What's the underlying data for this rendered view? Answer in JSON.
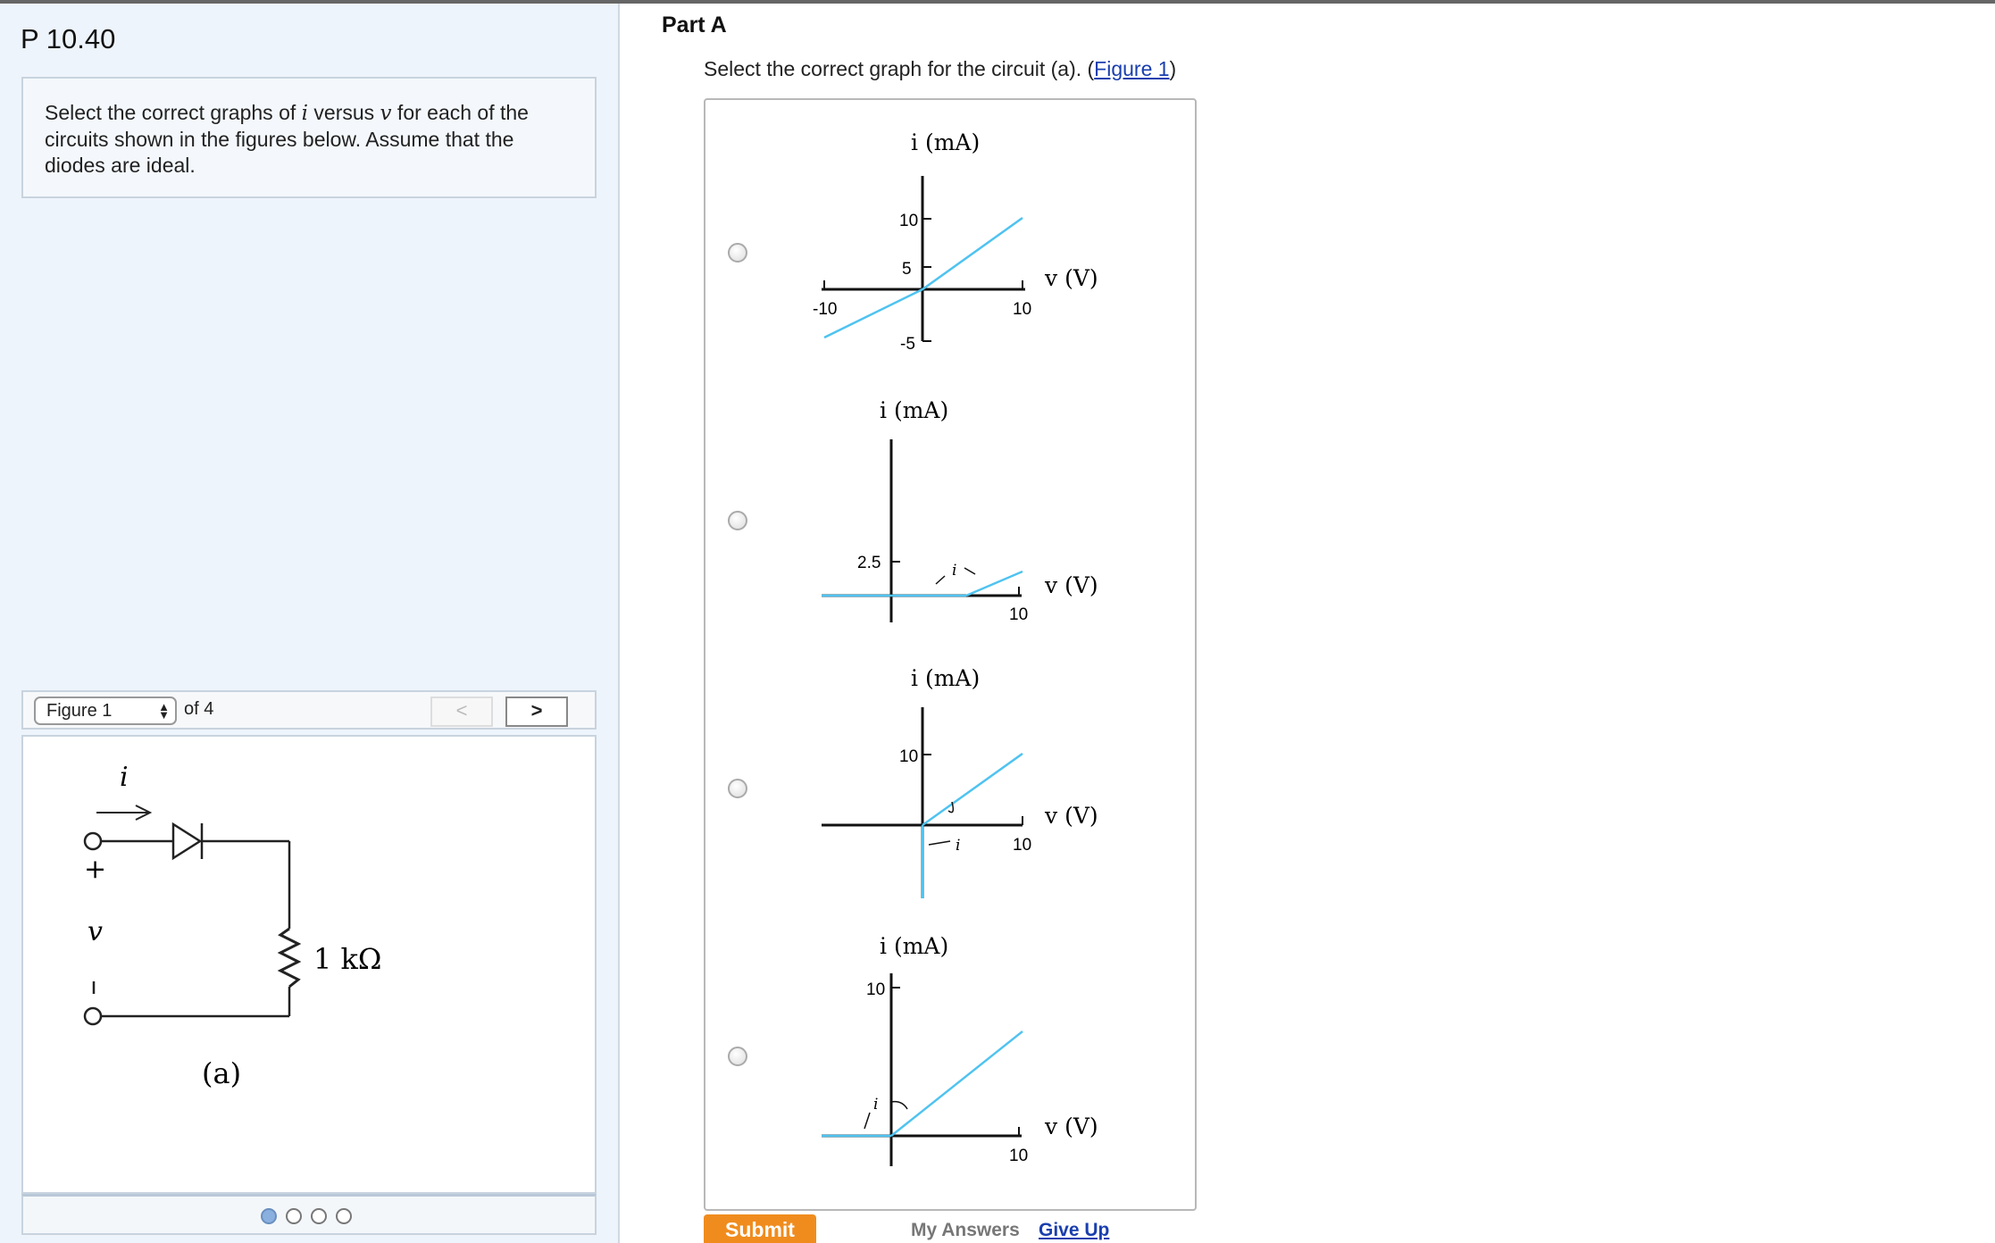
{
  "problem": {
    "title": "P 10.40",
    "text_before_i": "Select the correct graphs of ",
    "var_i": "i",
    "text_versus": " versus ",
    "var_v": "v",
    "text_after": " for each of the circuits shown in the figures below. Assume that the diodes are ideal."
  },
  "figure_nav": {
    "selected": "Figure 1",
    "of_label": "of 4",
    "prev_label": "<",
    "next_label": ">",
    "pages": 4,
    "current_page": 1
  },
  "figure": {
    "current_label": "i",
    "plus": "+",
    "minus": "–",
    "voltage_label": "v",
    "resistor_label": "1 kΩ",
    "caption": "(a)"
  },
  "part_a": {
    "heading": "Part A",
    "question_prefix": "Select the correct graph for the circuit (a). (",
    "figure_link": "Figure 1",
    "question_suffix": ")",
    "options": [
      {
        "y_label": "i (mA)",
        "x_label": "v (V)",
        "y_ticks": [
          "10",
          "5",
          "-5"
        ],
        "x_ticks": [
          "-10",
          "10"
        ]
      },
      {
        "y_label": "i (mA)",
        "x_label": "v (V)",
        "y_ticks": [
          "2.5"
        ],
        "x_ticks": [
          "10"
        ],
        "note": "i"
      },
      {
        "y_label": "i (mA)",
        "x_label": "v (V)",
        "y_ticks": [
          "10"
        ],
        "x_ticks": [
          "10"
        ],
        "note": "i"
      },
      {
        "y_label": "i (mA)",
        "x_label": "v (V)",
        "y_ticks": [
          "10"
        ],
        "x_ticks": [
          "10"
        ],
        "note": "i"
      }
    ]
  },
  "actions": {
    "submit": "Submit",
    "my_answers": "My Answers",
    "give_up": "Give Up"
  },
  "colors": {
    "curve": "#4fc3f0",
    "submit_bg": "#f08c1e",
    "link": "#1a3fae"
  }
}
